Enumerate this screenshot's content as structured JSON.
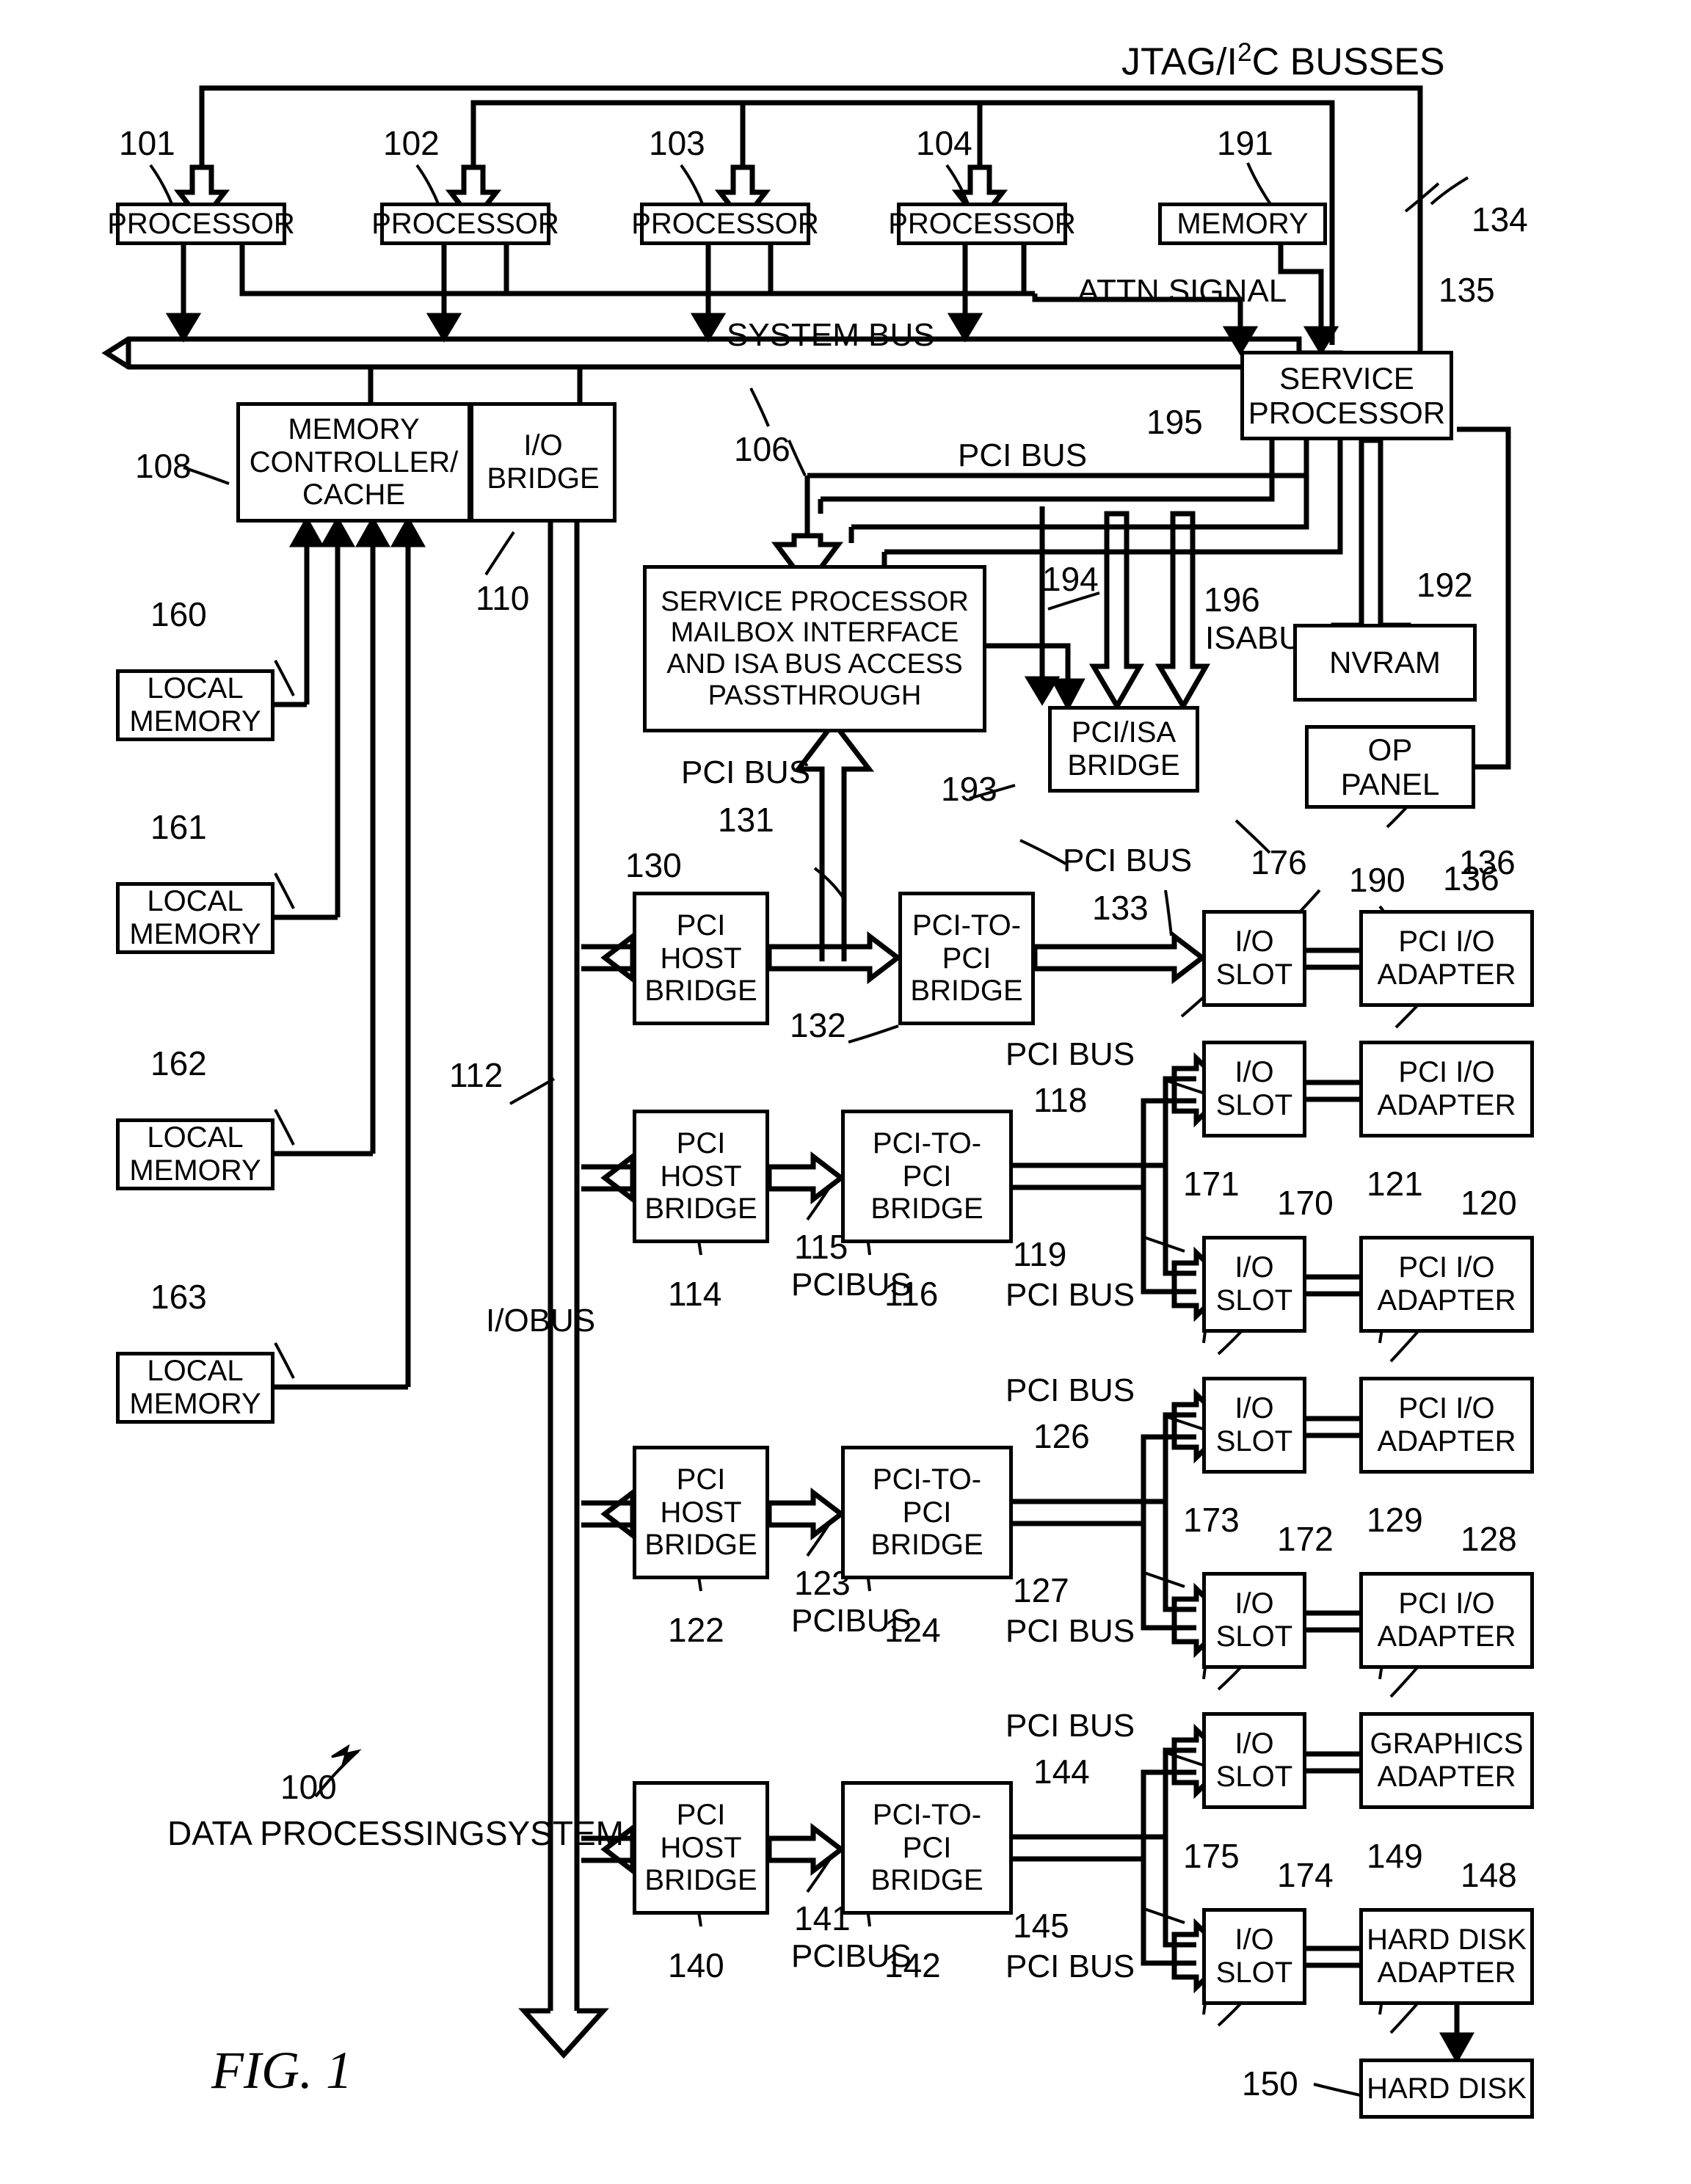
{
  "figure": {
    "caption": "FIG. 1",
    "system_label_number": "100",
    "system_label_line1": "DATA PROCESSING",
    "system_label_line2": "SYSTEM"
  },
  "top": {
    "jtag_label_pre": "JTAG/I",
    "jtag_label_sup": "2",
    "jtag_label_post": "C BUSSES",
    "attn_signal": "ATTN SIGNAL",
    "system_bus": "SYSTEM BUS",
    "io_bus_line1": "I/O",
    "io_bus_line2": "BUS"
  },
  "processors": [
    {
      "label": "PROCESSOR",
      "number": "101"
    },
    {
      "label": "PROCESSOR",
      "number": "102"
    },
    {
      "label": "PROCESSOR",
      "number": "103"
    },
    {
      "label": "PROCESSOR",
      "number": "104"
    }
  ],
  "blocks": {
    "memory": {
      "label": "MEMORY",
      "number": "191"
    },
    "service_processor": {
      "line1": "SERVICE",
      "line2": "PROCESSOR",
      "number": "135"
    },
    "memory_controller": {
      "line1": "MEMORY",
      "line2": "CONTROLLER/",
      "line3": "CACHE",
      "number": "108"
    },
    "io_bridge": {
      "line1": "I/O",
      "line2": "BRIDGE",
      "number": "110"
    },
    "mailbox": {
      "line1": "SERVICE PROCESSOR",
      "line2": "MAILBOX INTERFACE",
      "line3": "AND ISA BUS ACCESS",
      "line4": "PASSTHROUGH",
      "number": "194"
    },
    "pci_isa_bridge": {
      "line1": "PCI/ISA",
      "line2": "BRIDGE",
      "number": "193"
    },
    "nvram": {
      "label": "NVRAM",
      "number": "192"
    },
    "op_panel": {
      "line1": "OP",
      "line2": "PANEL",
      "number": "190"
    },
    "hard_disk": {
      "label": "HARD DISK",
      "number": "150"
    }
  },
  "local_memories": [
    {
      "line1": "LOCAL",
      "line2": "MEMORY",
      "number": "160"
    },
    {
      "line1": "LOCAL",
      "line2": "MEMORY",
      "number": "161"
    },
    {
      "line1": "LOCAL",
      "line2": "MEMORY",
      "number": "162"
    },
    {
      "line1": "LOCAL",
      "line2": "MEMORY",
      "number": "163"
    }
  ],
  "numbers": {
    "jtag_bus": "134",
    "system_bus": "106",
    "io_bus": "112",
    "pci_bus_195": "195",
    "isa_bus_196": "196",
    "isa_bus_label_line1": "ISA",
    "isa_bus_label_line2": "BUS",
    "op_panel_link": "136"
  },
  "bus_label_text": "PCI BUS",
  "host_bridge_label": {
    "line1": "PCI",
    "line2": "HOST",
    "line3": "BRIDGE"
  },
  "ptp_bridge_label": {
    "line1": "PCI-TO-",
    "line2": "PCI",
    "line3": "BRIDGE"
  },
  "io_slot_label": {
    "line1": "I/O",
    "line2": "SLOT"
  },
  "adapter_labels": {
    "pci_io": {
      "line1": "PCI I/O",
      "line2": "ADAPTER"
    },
    "graphics": {
      "line1": "GRAPHICS",
      "line2": "ADAPTER"
    },
    "hard_disk": {
      "line1": "HARD DISK",
      "line2": "ADAPTER"
    }
  },
  "pci_rows": [
    {
      "host_bridge_number": "130",
      "host_to_ptp_bus_number": "132",
      "upstream_bus_number": "131",
      "upstream_bus_label": "PCI BUS",
      "downstream_bus_label": "PCI BUS",
      "downstream_bus_number": "133",
      "slots": [
        {
          "slot_number": "176",
          "adapter_number": "136",
          "adapter_type": "pci_io"
        }
      ]
    },
    {
      "host_bridge_number": "114",
      "host_to_ptp_bus_number": "115",
      "host_to_ptp_bus_label_line1": "PCI",
      "host_to_ptp_bus_label_line2": "BUS",
      "ptp_number": "116",
      "bus_top_label": "PCI BUS",
      "bus_top_number": "118",
      "bus_bottom_number": "119",
      "bus_bottom_label": "PCI BUS",
      "slots": [
        {
          "slot_number": "170",
          "slot_ref": "171",
          "adapter_number": "120",
          "adapter_ref": "121",
          "adapter_type": "pci_io"
        }
      ]
    },
    {
      "host_bridge_number": "122",
      "host_to_ptp_bus_number": "123",
      "host_to_ptp_bus_label_line1": "PCI",
      "host_to_ptp_bus_label_line2": "BUS",
      "ptp_number": "124",
      "bus_top_label": "PCI BUS",
      "bus_top_number": "126",
      "bus_bottom_number": "127",
      "bus_bottom_label": "PCI BUS",
      "slots": [
        {
          "slot_number": "172",
          "slot_ref": "173",
          "adapter_number": "128",
          "adapter_ref": "129",
          "adapter_type": "pci_io"
        }
      ]
    },
    {
      "host_bridge_number": "140",
      "host_to_ptp_bus_number": "141",
      "host_to_ptp_bus_label_line1": "PCI",
      "host_to_ptp_bus_label_line2": "BUS",
      "ptp_number": "142",
      "bus_top_label": "PCI BUS",
      "bus_top_number": "144",
      "bus_bottom_number": "145",
      "bus_bottom_label": "PCI BUS",
      "slots": [
        {
          "slot_number": "174",
          "slot_ref": "175",
          "adapter_number": "148",
          "adapter_ref": "149",
          "adapter_type": "graphics_and_hdd"
        }
      ]
    }
  ]
}
